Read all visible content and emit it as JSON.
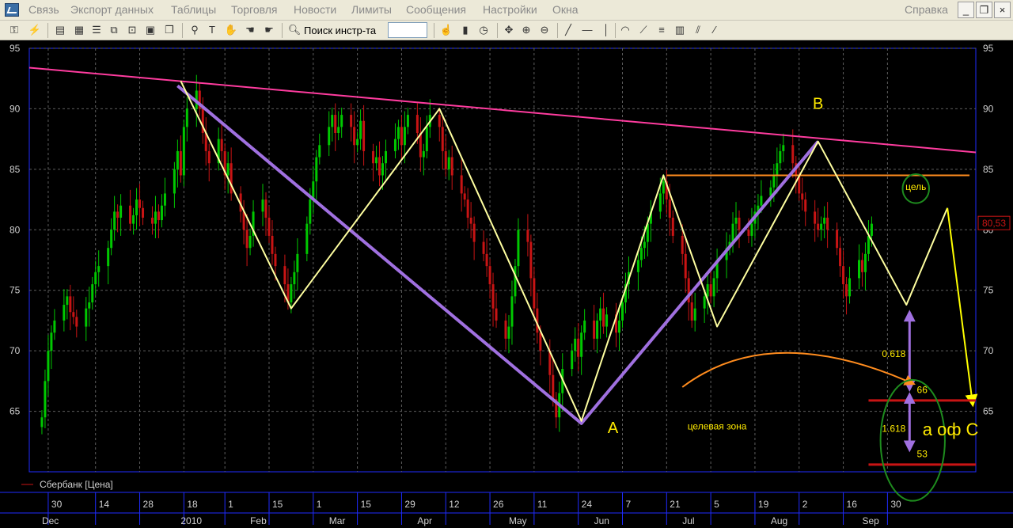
{
  "menu": {
    "items": [
      "Связь",
      "Экспорт данных",
      "Таблицы",
      "Торговля",
      "Новости",
      "Лимиты",
      "Сообщения",
      "Настройки",
      "Окна"
    ],
    "help": "Справка",
    "minimize": "_",
    "restore": "❐",
    "close": "×"
  },
  "toolbar": {
    "search_label": "Поиск инстр-та",
    "search_value": "",
    "icons": [
      "key-icon",
      "unplug-icon",
      "chart-window-icon",
      "chart-edit-icon",
      "table-icon",
      "layers-icon",
      "zoom-window-icon",
      "window-tile-icon",
      "pin-icon",
      "text-tool-icon",
      "hand-icon",
      "hand-two-icon",
      "hand-three-icon",
      "search-icon",
      "hand-pan-icon",
      "bar-chart-icon",
      "clock-icon",
      "crosshair-icon",
      "zoom-in-icon",
      "zoom-out-icon",
      "line-tool-icon",
      "hline-tool-icon",
      "vline-tool-icon",
      "arc-tool-icon",
      "fan-tool-icon",
      "fibo-tool-icon",
      "grid-tool-icon",
      "channel-tool-icon"
    ]
  },
  "colors": {
    "background": "#000000",
    "grid": "#5e5e5e",
    "frame": "#1f2bff",
    "up_candle": "#00c800",
    "down_candle": "#c81414",
    "resistance_line": "#ff3c9f",
    "zigzag": "#ffffa0",
    "big_wave": "#a070e0",
    "horizontal_level": "#ff8c1e",
    "target_lines": "#c81414",
    "forecast_arrow": "#ffff00",
    "target_ellipse": "#1e8c1e",
    "label_text": "#ffea00"
  },
  "chart_data": {
    "type": "candlestick",
    "instrument": "Сбербанк [Цена]",
    "last_price_label": "80,53",
    "last_price": 80.53,
    "ylim": [
      60,
      95
    ],
    "y_ticks": [
      65,
      70,
      75,
      80,
      85,
      90,
      95
    ],
    "xlim": [
      "2009-12-24",
      "2010-10-20"
    ],
    "x_day_ticks": [
      {
        "date": "2009-12-30",
        "label": "30"
      },
      {
        "date": "2010-01-14",
        "label": "14"
      },
      {
        "date": "2010-01-28",
        "label": "28"
      },
      {
        "date": "2010-02-11",
        "label": "18"
      },
      {
        "date": "2010-02-24",
        "label": "1"
      },
      {
        "date": "2010-03-10",
        "label": "15"
      },
      {
        "date": "2010-03-24",
        "label": "1"
      },
      {
        "date": "2010-04-07",
        "label": "15"
      },
      {
        "date": "2010-04-21",
        "label": "29"
      },
      {
        "date": "2010-05-05",
        "label": "12"
      },
      {
        "date": "2010-05-19",
        "label": "26"
      },
      {
        "date": "2010-06-02",
        "label": "11"
      },
      {
        "date": "2010-06-16",
        "label": "24"
      },
      {
        "date": "2010-06-30",
        "label": "7"
      },
      {
        "date": "2010-07-14",
        "label": "21"
      },
      {
        "date": "2010-07-28",
        "label": "5"
      },
      {
        "date": "2010-08-11",
        "label": "19"
      },
      {
        "date": "2010-08-25",
        "label": "2"
      },
      {
        "date": "2010-09-08",
        "label": "16"
      },
      {
        "date": "2010-09-22",
        "label": "30"
      }
    ],
    "x_month_ticks": [
      {
        "date": "2009-12-28",
        "label": "Dec"
      },
      {
        "date": "2010-02-10",
        "label": "2010"
      },
      {
        "date": "2010-03-04",
        "label": "Feb"
      },
      {
        "date": "2010-03-29",
        "label": "Mar"
      },
      {
        "date": "2010-04-26",
        "label": "Apr"
      },
      {
        "date": "2010-05-25",
        "label": "May"
      },
      {
        "date": "2010-06-21",
        "label": "Jun"
      },
      {
        "date": "2010-07-19",
        "label": "Jul"
      },
      {
        "date": "2010-08-16",
        "label": "Aug"
      },
      {
        "date": "2010-09-14",
        "label": "Sep"
      }
    ],
    "closes": [
      64.5,
      67.5,
      70.0,
      71.5,
      72.5,
      73.8,
      74.5,
      73.2,
      72.8,
      72.0,
      73.5,
      74.0,
      75.5,
      76.5,
      77.0,
      78.5,
      80.0,
      81.5,
      81.0,
      82.0,
      80.5,
      81.2,
      82.5,
      81.8,
      81.0,
      80.5,
      81.5,
      80.8,
      82.0,
      83.0,
      85.0,
      86.5,
      84.5,
      88.5,
      90.0,
      91.5,
      90.0,
      88.0,
      86.5,
      85.5,
      87.5,
      86.5,
      84.5,
      85.5,
      83.0,
      81.5,
      80.0,
      78.5,
      79.5,
      81.5,
      82.5,
      81.0,
      79.5,
      78.0,
      77.0,
      75.5,
      74.0,
      75.5,
      76.5,
      78.0,
      80.5,
      82.5,
      84.0,
      86.0,
      87.0,
      88.5,
      89.5,
      88.0,
      88.5,
      89.5,
      88.5,
      87.0,
      87.5,
      89.0,
      86.5,
      85.5,
      86.0,
      84.5,
      85.5,
      86.5,
      87.5,
      88.5,
      87.0,
      88.5,
      89.5,
      88.0,
      86.0,
      86.5,
      88.5,
      89.5,
      88.5,
      86.5,
      85.0,
      86.0,
      84.5,
      83.0,
      82.5,
      81.0,
      80.5,
      79.0,
      78.0,
      77.0,
      75.5,
      73.5,
      72.5,
      71.0,
      72.0,
      74.5,
      77.0,
      80.0,
      79.0,
      76.0,
      73.5,
      71.5,
      70.0,
      68.0,
      66.0,
      64.5,
      66.5,
      68.5,
      70.0,
      71.0,
      69.5,
      71.5,
      72.5,
      71.0,
      72.5,
      73.5,
      72.0,
      73.0,
      71.5,
      72.5,
      74.0,
      75.5,
      76.5,
      77.5,
      78.5,
      79.0,
      80.5,
      81.5,
      83.0,
      84.0,
      82.5,
      81.0,
      79.5,
      78.0,
      76.0,
      74.0,
      72.5,
      73.5,
      74.5,
      75.5,
      74.5,
      76.0,
      77.5,
      78.5,
      79.0,
      80.5,
      81.0,
      80.0,
      79.5,
      80.5,
      81.5,
      82.0,
      82.8,
      83.5,
      84.5,
      85.5,
      86.5,
      87.0,
      85.5,
      84.5,
      83.0,
      82.5,
      81.5,
      80.5,
      80.0,
      80.5,
      81.0,
      80.0,
      78.5,
      77.0,
      75.5,
      74.5,
      76.0,
      77.5,
      76.5,
      78.0,
      79.5,
      80.5
    ],
    "resistance_line": [
      {
        "date": "2009-12-24",
        "value": 93.4
      },
      {
        "date": "2010-10-20",
        "value": 86.4
      }
    ],
    "zigzag": [
      {
        "date": "2010-02-10",
        "value": 92.3
      },
      {
        "date": "2010-03-17",
        "value": 73.5
      },
      {
        "date": "2010-05-03",
        "value": 90.0
      },
      {
        "date": "2010-06-17",
        "value": 64.2
      },
      {
        "date": "2010-07-13",
        "value": 84.5
      },
      {
        "date": "2010-07-30",
        "value": 72.0
      },
      {
        "date": "2010-08-31",
        "value": 87.3
      },
      {
        "date": "2010-09-28",
        "value": 73.8
      },
      {
        "date": "2010-10-11",
        "value": 81.8
      }
    ],
    "big_wave": [
      {
        "date": "2010-02-09",
        "value": 91.9
      },
      {
        "date": "2010-06-17",
        "value": 64.0
      },
      {
        "date": "2010-08-31",
        "value": 87.3
      }
    ],
    "horizontal_level": {
      "start": "2010-07-14",
      "end": "2010-10-18",
      "value": 84.5
    },
    "forecast": [
      {
        "date": "2010-10-11",
        "value": 81.8
      },
      {
        "date": "2010-10-19",
        "value": 65.6
      }
    ],
    "target_lines": [
      {
        "start": "2010-09-16",
        "end": "2010-10-20",
        "value": 65.9
      },
      {
        "start": "2010-09-16",
        "end": "2010-10-20",
        "value": 60.6
      }
    ],
    "fib_arrows": [
      {
        "date": "2010-09-29",
        "from": 73.0,
        "to": 67.0
      },
      {
        "date": "2010-09-29",
        "from": 66.2,
        "to": 62.0
      }
    ],
    "curved_arrow": {
      "start": [
        "2010-07-19",
        67.0
      ],
      "ctrl": [
        "2010-08-16",
        72.5
      ],
      "end": [
        "2010-09-30",
        67.3
      ]
    },
    "target_ellipse": {
      "center": [
        "2010-10-01",
        83.4
      ],
      "rx_days": 4.2,
      "ry_value": 1.2
    },
    "zone_ellipse": {
      "center": [
        "2010-09-30",
        62.6
      ],
      "rx_days": 10.2,
      "ry_value": 5.0
    },
    "annotations": [
      {
        "text": "A",
        "date": "2010-06-27",
        "value": 63.2,
        "size": "large"
      },
      {
        "text": "B",
        "date": "2010-08-31",
        "value": 90.0,
        "size": "large"
      },
      {
        "text": "цель",
        "date": "2010-10-01",
        "value": 83.3,
        "size": "small"
      },
      {
        "text": "0.618",
        "date": "2010-09-24",
        "value": 69.5,
        "size": "small"
      },
      {
        "text": "66",
        "date": "2010-10-03",
        "value": 66.5,
        "size": "small"
      },
      {
        "text": "1.618",
        "date": "2010-09-24",
        "value": 63.3,
        "size": "small"
      },
      {
        "text": "53",
        "date": "2010-10-03",
        "value": 61.2,
        "size": "small"
      },
      {
        "text": "целевая зона",
        "date": "2010-07-30",
        "value": 63.5,
        "size": "small"
      },
      {
        "text": "а оф С",
        "date": "2010-10-12",
        "value": 63.0,
        "size": "xlarge"
      }
    ]
  }
}
